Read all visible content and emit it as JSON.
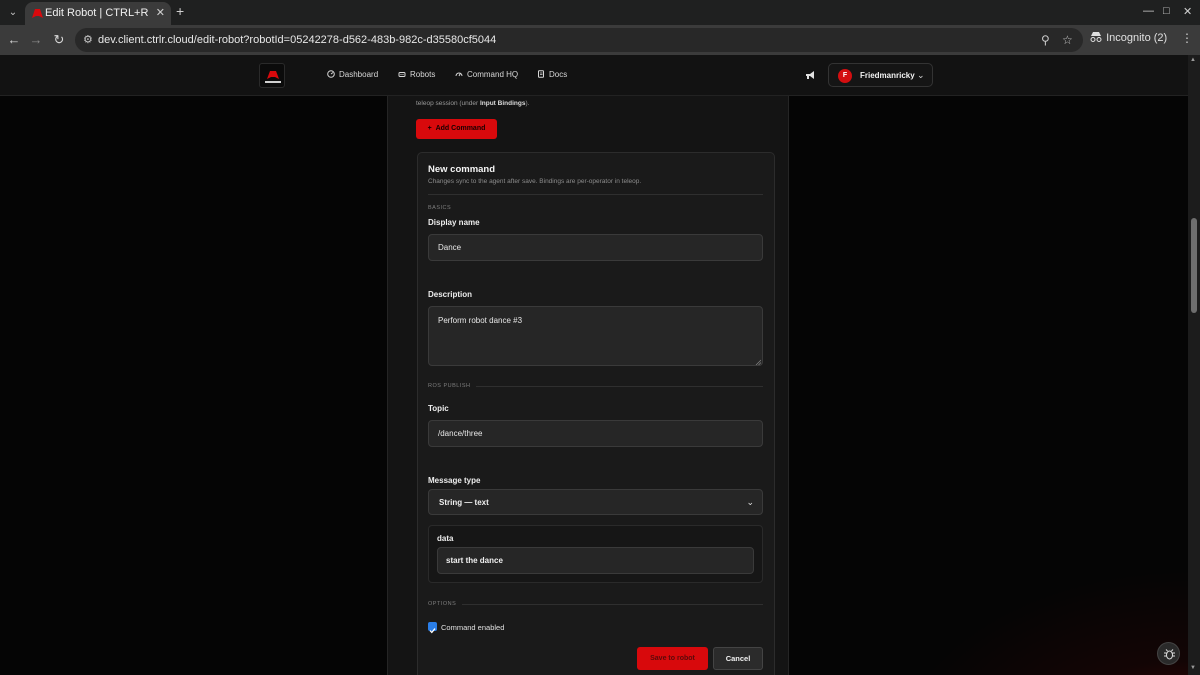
{
  "browser": {
    "tab_title": "Edit Robot | CTRL+R",
    "url": "dev.client.ctrlr.cloud/edit-robot?robotId=05242278-d562-483b-982c-d35580cf5044",
    "profile_label": "Incognito (2)"
  },
  "header": {
    "nav": [
      {
        "label": "Dashboard",
        "icon": "dashboard-icon"
      },
      {
        "label": "Robots",
        "icon": "robot-icon"
      },
      {
        "label": "Command HQ",
        "icon": "command-icon"
      },
      {
        "label": "Docs",
        "icon": "docs-icon"
      }
    ],
    "user": {
      "initial": "F",
      "name": "Friedmanricky"
    }
  },
  "page": {
    "intro_prefix": "teleop session (under ",
    "intro_bold": "Input Bindings",
    "intro_suffix": ").",
    "add_command_label": "Add Command"
  },
  "form": {
    "title": "New command",
    "subtitle": "Changes sync to the agent after save. Bindings are per-operator in teleop.",
    "section_basics": "BASICS",
    "display_name_label": "Display name",
    "display_name_value": "Dance",
    "description_label": "Description",
    "description_value": "Perform robot dance #3",
    "section_ros": "ROS PUBLISH",
    "topic_label": "Topic",
    "topic_value": "/dance/three",
    "message_type_label": "Message type",
    "message_type_value": "String — text",
    "data_label": "data",
    "data_value": "start the dance",
    "section_options": "OPTIONS",
    "enabled_label": "Command enabled",
    "enabled_checked": true,
    "save_label": "Save to robot",
    "cancel_label": "Cancel"
  },
  "colors": {
    "accent": "#d8090c",
    "checkbox": "#2a7ee8"
  }
}
